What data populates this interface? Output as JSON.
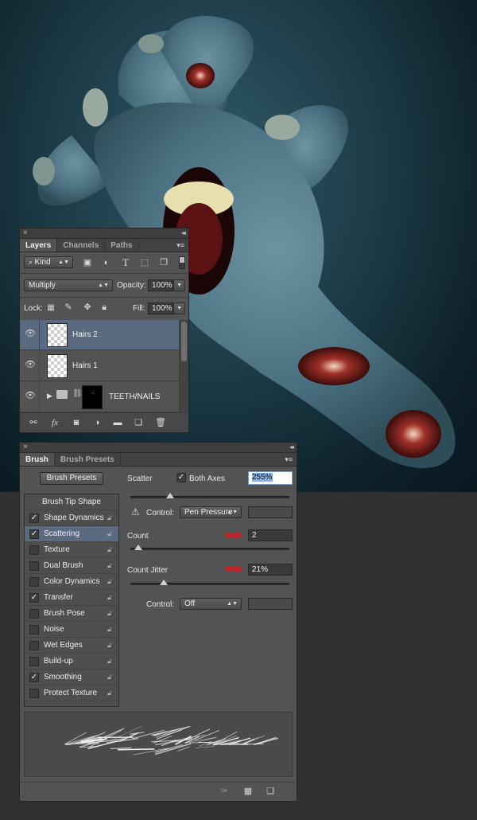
{
  "layers_panel": {
    "close_glyph": "×",
    "collapse_glyph": "◂◂",
    "tabs": [
      {
        "label": "Layers",
        "active": true
      },
      {
        "label": "Channels",
        "active": false
      },
      {
        "label": "Paths",
        "active": false
      }
    ],
    "menu_glyph": "▾≡",
    "filter": {
      "label": "Kind",
      "icon": "search-icon"
    },
    "blend_mode": "Multiply",
    "opacity_label": "Opacity:",
    "opacity_value": "100%",
    "lock_label": "Lock:",
    "fill_label": "Fill:",
    "fill_value": "100%",
    "layers": [
      {
        "name": "Hairs 2",
        "selected": true,
        "type": "layer"
      },
      {
        "name": "Hairs 1",
        "selected": false,
        "type": "layer"
      },
      {
        "name": "TEETH/NAILS",
        "selected": false,
        "type": "group"
      }
    ],
    "bottom_icons": [
      "link-icon",
      "fx-icon",
      "mask-icon",
      "adjustment-icon",
      "folder-icon",
      "new-layer-icon",
      "trash-icon"
    ],
    "fx_label": "fx"
  },
  "brush_panel": {
    "close_glyph": "×",
    "collapse_glyph": "◂◂",
    "tabs": [
      {
        "label": "Brush",
        "active": true
      },
      {
        "label": "Brush Presets",
        "active": false
      }
    ],
    "menu_glyph": "▾≡",
    "brush_presets_button": "Brush Presets",
    "options": [
      {
        "label": "Brush Tip Shape",
        "checkbox": false,
        "checked": false,
        "selected": false
      },
      {
        "label": "Shape Dynamics",
        "checkbox": true,
        "checked": true,
        "selected": false
      },
      {
        "label": "Scattering",
        "checkbox": true,
        "checked": true,
        "selected": true
      },
      {
        "label": "Texture",
        "checkbox": true,
        "checked": false,
        "selected": false
      },
      {
        "label": "Dual Brush",
        "checkbox": true,
        "checked": false,
        "selected": false
      },
      {
        "label": "Color Dynamics",
        "checkbox": true,
        "checked": false,
        "selected": false
      },
      {
        "label": "Transfer",
        "checkbox": true,
        "checked": true,
        "selected": false
      },
      {
        "label": "Brush Pose",
        "checkbox": true,
        "checked": false,
        "selected": false
      },
      {
        "label": "Noise",
        "checkbox": true,
        "checked": false,
        "selected": false
      },
      {
        "label": "Wet Edges",
        "checkbox": true,
        "checked": false,
        "selected": false
      },
      {
        "label": "Build-up",
        "checkbox": true,
        "checked": false,
        "selected": false
      },
      {
        "label": "Smoothing",
        "checkbox": true,
        "checked": true,
        "selected": false
      },
      {
        "label": "Protect Texture",
        "checkbox": true,
        "checked": false,
        "selected": false
      }
    ],
    "check_glyph": "✓",
    "scatter_label": "Scatter",
    "both_axes_label": "Both Axes",
    "both_axes_checked": true,
    "scatter_value": "255%",
    "scatter_slider_level": 0.25,
    "control1_label": "Control:",
    "control1_value": "Pen Pressure",
    "warning_glyph": "⚠",
    "count_label": "Count",
    "count_value": "2",
    "count_slider_level": 0.05,
    "count_jitter_label": "Count Jitter",
    "count_jitter_value": "21%",
    "count_jitter_slider_level": 0.21,
    "control2_label": "Control:",
    "control2_value": "Off",
    "bottom_icons": [
      "brush-preview-icon",
      "grid-icon",
      "new-preset-icon"
    ]
  },
  "colors": {
    "panel_bg": "#535353",
    "selected_row": "#5a6a80",
    "annotation_arrow": "#c0272d",
    "artwork_bg": "#1c3a46"
  }
}
